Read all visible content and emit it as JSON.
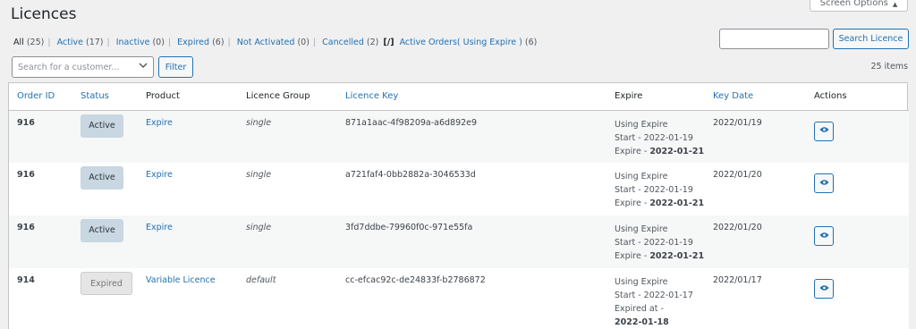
{
  "screen_options": {
    "label": "Screen Options",
    "arrow_icon": "triangle-up-icon"
  },
  "page_title": "Licences",
  "filters": [
    {
      "label": "All",
      "count": "(25)",
      "current": true
    },
    {
      "label": "Active",
      "count": "(17)",
      "current": false
    },
    {
      "label": "Inactive",
      "count": "(0)",
      "current": false
    },
    {
      "label": "Expired",
      "count": "(6)",
      "current": false
    },
    {
      "label": "Not Activated",
      "count": "(0)",
      "current": false
    },
    {
      "label": "Cancelled",
      "count": "(2)",
      "current": false
    },
    {
      "label": "Active Orders( Using Expire )",
      "count": "(6)",
      "current": false
    }
  ],
  "filter_bracket": "[/]",
  "search": {
    "value": "",
    "button": "Search Licence"
  },
  "customer_select": {
    "placeholder": "Search for a customer..."
  },
  "filter_button": "Filter",
  "items_count": "25 items",
  "columns": [
    "Order ID",
    "Status",
    "Product",
    "Licence Group",
    "Licence Key",
    "Expire",
    "Key Date",
    "Actions"
  ],
  "rows": [
    {
      "order_id": "916",
      "status": "Active",
      "product": "Expire",
      "group": "single",
      "key": "871a1aac-4f98209a-a6d892e9",
      "expire": [
        "Using Expire",
        "Start - 2022-01-19"
      ],
      "expire_prefix": "Expire - ",
      "expire_bold": "2022-01-21",
      "key_date": "2022/01/19"
    },
    {
      "order_id": "916",
      "status": "Active",
      "product": "Expire",
      "group": "single",
      "key": "a721faf4-0bb2882a-3046533d",
      "expire": [
        "Using Expire",
        "Start - 2022-01-19"
      ],
      "expire_prefix": "Expire - ",
      "expire_bold": "2022-01-21",
      "key_date": "2022/01/20"
    },
    {
      "order_id": "916",
      "status": "Active",
      "product": "Expire",
      "group": "single",
      "key": "3fd7ddbe-79960f0c-971e55fa",
      "expire": [
        "Using Expire",
        "Start - 2022-01-19"
      ],
      "expire_prefix": "Expire - ",
      "expire_bold": "2022-01-21",
      "key_date": "2022/01/20"
    },
    {
      "order_id": "914",
      "status": "Expired",
      "product": "Variable Licence",
      "group": "default",
      "key": "cc-efcac92c-de24833f-b2786872",
      "expire": [
        "Using Expire",
        "Start - 2022-01-17",
        "Expired at -"
      ],
      "expire_prefix": "",
      "expire_bold": "2022-01-18",
      "key_date": "2022/01/17"
    }
  ],
  "colors": {
    "link": "#2271b1",
    "active_badge": "#c8d7e1",
    "expired_badge": "#e5e5e5"
  }
}
